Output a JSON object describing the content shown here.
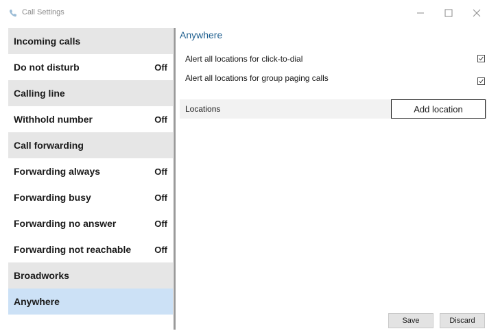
{
  "window": {
    "title": "Call Settings",
    "app_icon": "call-settings-icon",
    "controls": [
      "minimize-icon",
      "maximize-icon",
      "close-icon"
    ]
  },
  "sidebar": {
    "items": [
      {
        "label": "Incoming calls",
        "type": "header"
      },
      {
        "label": "Do not disturb",
        "state": "Off"
      },
      {
        "label": "Calling line",
        "type": "header"
      },
      {
        "label": "Withhold number",
        "state": "Off"
      },
      {
        "label": "Call forwarding",
        "type": "header"
      },
      {
        "label": "Forwarding always",
        "state": "Off"
      },
      {
        "label": "Forwarding busy",
        "state": "Off"
      },
      {
        "label": "Forwarding no answer",
        "state": "Off"
      },
      {
        "label": "Forwarding not reachable",
        "state": "Off"
      },
      {
        "label": "Broadworks",
        "type": "header"
      },
      {
        "label": "Anywhere",
        "selected": true
      }
    ]
  },
  "main": {
    "title": "Anywhere",
    "options": [
      {
        "label": "Alert all locations for click-to-dial",
        "checked": true
      },
      {
        "label": "Alert all locations for group paging calls",
        "checked": true
      }
    ],
    "locations_label": "Locations",
    "add_location_label": "Add location"
  },
  "footer": {
    "save_label": "Save",
    "discard_label": "Discard"
  },
  "colors": {
    "selected_bg": "#cce1f6",
    "header_bg": "#e6e6e6",
    "title_blue": "#1f5f8f"
  }
}
